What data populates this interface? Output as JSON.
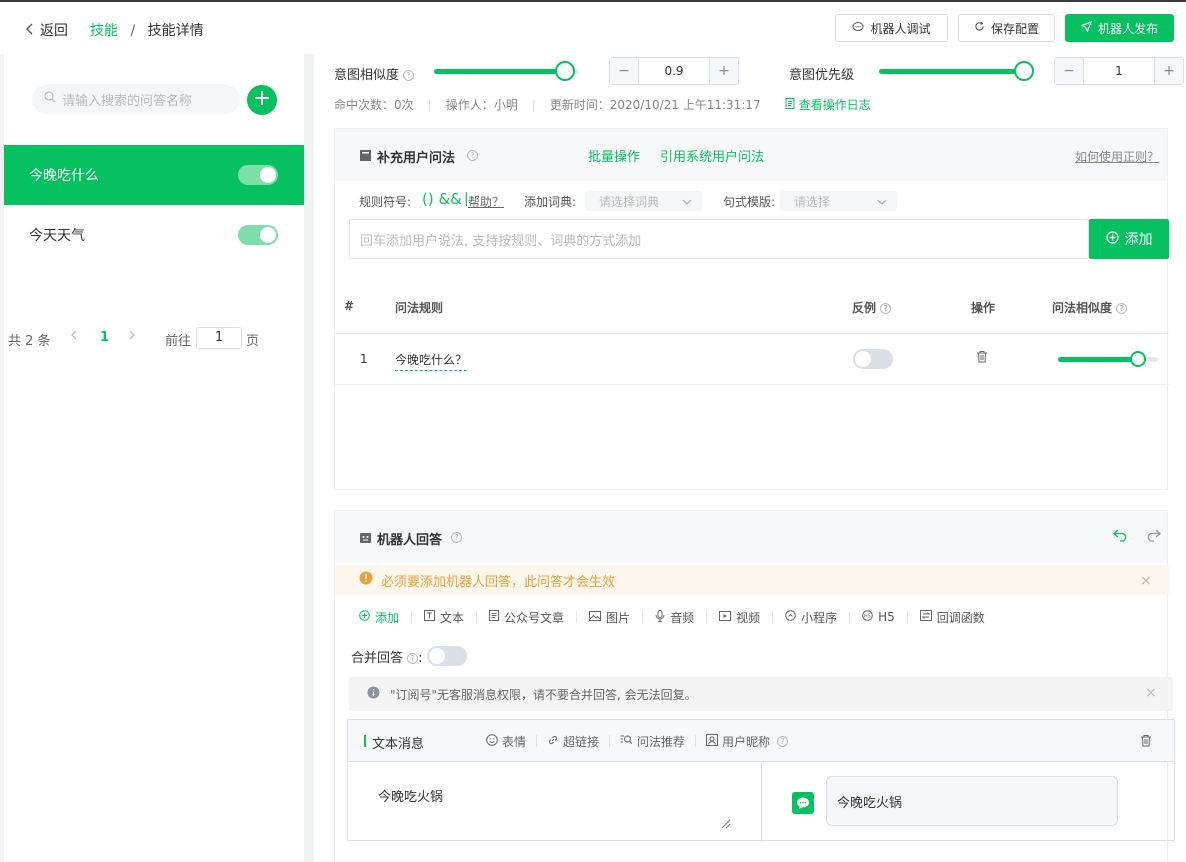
{
  "header": {
    "back_label": "返回",
    "breadcrumb_parent": "技能",
    "breadcrumb_sep": "/",
    "breadcrumb_current": "技能详情",
    "debug_btn": "机器人调试",
    "save_btn": "保存配置",
    "publish_btn": "机器人发布"
  },
  "sidebar": {
    "search_placeholder": "请输入搜索的问答名称",
    "add_icon": "+",
    "items": [
      {
        "label": "今晚吃什么",
        "enabled": true,
        "active": true
      },
      {
        "label": "今天天气",
        "enabled": true,
        "active": false
      }
    ],
    "pager": {
      "total_text": "共 2 条",
      "current_page": "1",
      "goto_label": "前往",
      "goto_value": "1",
      "page_suffix": "页"
    }
  },
  "intent": {
    "similarity_label": "意图相似度",
    "similarity_value": "0.9",
    "similarity_slider": 0.9,
    "priority_label": "意图优先级",
    "priority_value": "1",
    "priority_slider": 1.0,
    "minus": "−",
    "plus": "+"
  },
  "meta": {
    "hits": "命中次数：0次",
    "operator": "操作人：小明",
    "updated": "更新时间：2020/10/21 上午11:31:17",
    "log_link": "查看操作日志"
  },
  "user_questions": {
    "title": "补充用户问法",
    "batch_link": "批量操作",
    "system_link": "引用系统用户问法",
    "regex_help": "如何使用正则？",
    "rule_symbol_label": "规则符号:",
    "rule_symbols": "() &&",
    "rule_pipe": "|",
    "help_link": "帮助？",
    "dict_label": "添加词典:",
    "dict_placeholder": "请选择词典",
    "template_label": "句式模版:",
    "template_placeholder": "请选择",
    "input_placeholder": "回车添加用户说法, 支持按规则、词典的方式添加",
    "add_btn": "添加",
    "columns": [
      "#",
      "问法规则",
      "反例",
      "操作",
      "问法相似度"
    ],
    "rows": [
      {
        "index": "1",
        "rule": "今晚吃什么？",
        "negative": false,
        "similarity": 0.8
      }
    ]
  },
  "robot_answer": {
    "title": "机器人回答",
    "warning": "必须要添加机器人回答，此问答才会生效",
    "toolbar": [
      "添加",
      "文本",
      "公众号文章",
      "图片",
      "音频",
      "视频",
      "小程序",
      "H5",
      "回调函数"
    ],
    "merge_label": "合并回答",
    "merge_colon": ":",
    "merge_enabled": false,
    "info": "\"订阅号\"无客服消息权限，请不要合并回答, 会无法回复。",
    "message": {
      "type_label": "文本消息",
      "tools": [
        "表情",
        "超链接",
        "问法推荐",
        "用户昵称"
      ],
      "text": "今晚吃火锅",
      "preview": "今晚吃火锅"
    }
  },
  "colors": {
    "accent": "#07c160",
    "warning": "#e6a23c"
  }
}
